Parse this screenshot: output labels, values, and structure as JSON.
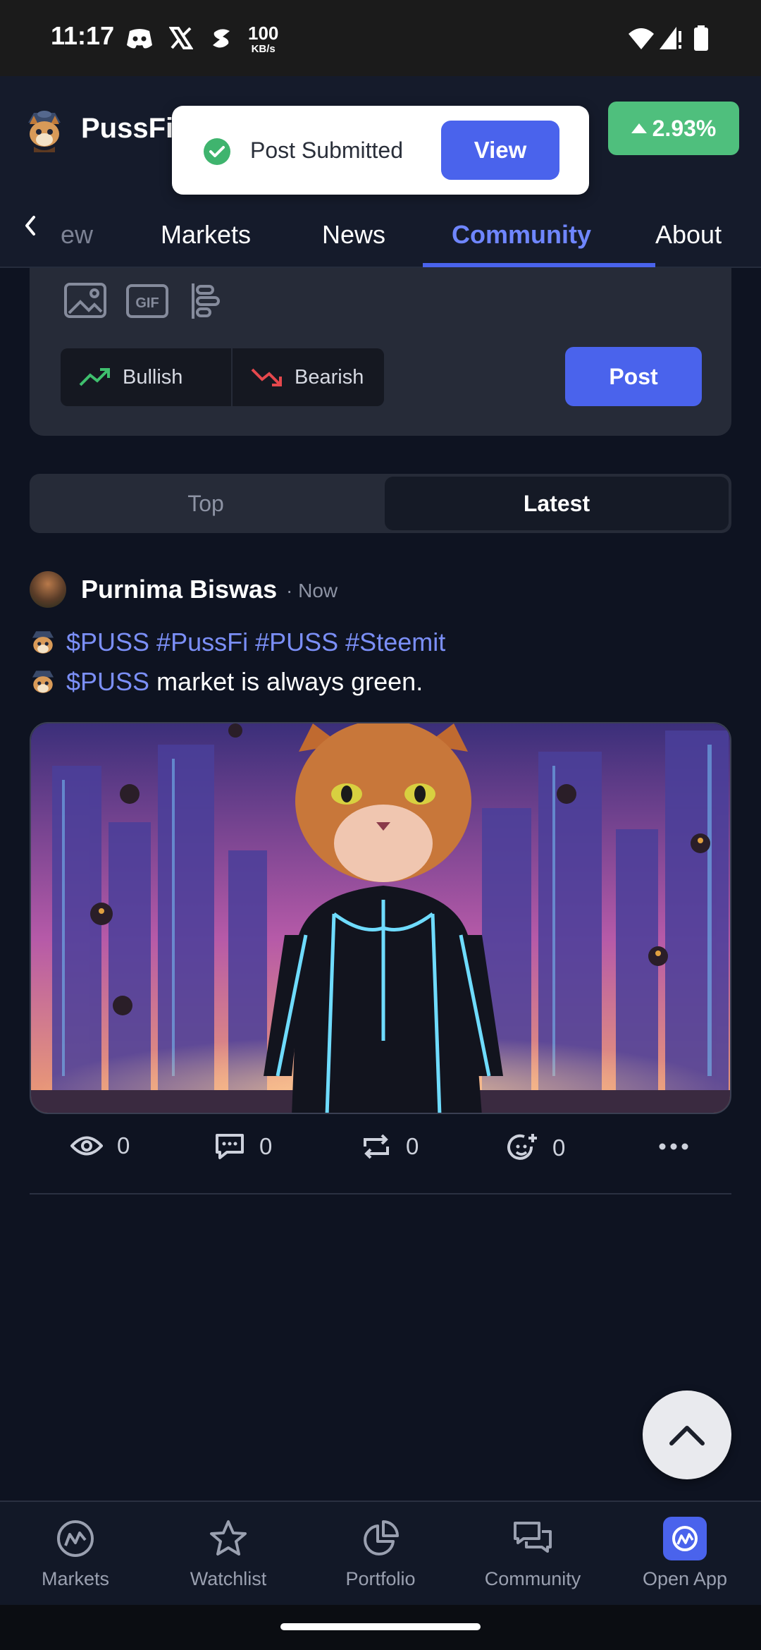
{
  "status_bar": {
    "time": "11:17",
    "speed_value": "100",
    "speed_unit": "KB/s"
  },
  "header": {
    "app_name": "PussFi",
    "price_change": "2.93%"
  },
  "toast": {
    "message": "Post Submitted",
    "action": "View"
  },
  "tabs": [
    {
      "label": "ew"
    },
    {
      "label": "Markets"
    },
    {
      "label": "News"
    },
    {
      "label": "Community"
    },
    {
      "label": "About"
    }
  ],
  "composer": {
    "gif_label": "GIF",
    "bullish": "Bullish",
    "bearish": "Bearish",
    "post": "Post"
  },
  "sort": {
    "top": "Top",
    "latest": "Latest"
  },
  "post": {
    "author": "Purnima Biswas",
    "time": "· Now",
    "line1_tags": "$PUSS #PussFi #PUSS #Steemit",
    "line2_tag": "$PUSS",
    "line2_text": " market is always green.",
    "views": "0",
    "comments": "0",
    "reposts": "0",
    "reactions": "0"
  },
  "bottom_nav": [
    {
      "label": "Markets"
    },
    {
      "label": "Watchlist"
    },
    {
      "label": "Portfolio"
    },
    {
      "label": "Community"
    },
    {
      "label": "Open App"
    }
  ],
  "colors": {
    "accent": "#4a63ec",
    "positive": "#4fbf7d",
    "negative": "#e5484d",
    "background": "#0e1321"
  }
}
